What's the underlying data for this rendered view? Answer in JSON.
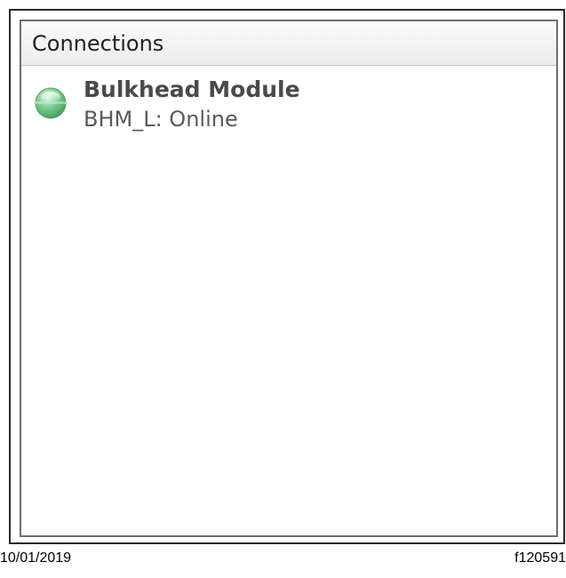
{
  "panel": {
    "title": "Connections",
    "items": [
      {
        "name": "Bulkhead Module",
        "status": "BHM_L: Online",
        "indicator_icon": "status-led-icon",
        "indicator_color": "#4caf6a"
      }
    ]
  },
  "figure": {
    "date": "10/01/2019",
    "figure_id": "f120591"
  }
}
